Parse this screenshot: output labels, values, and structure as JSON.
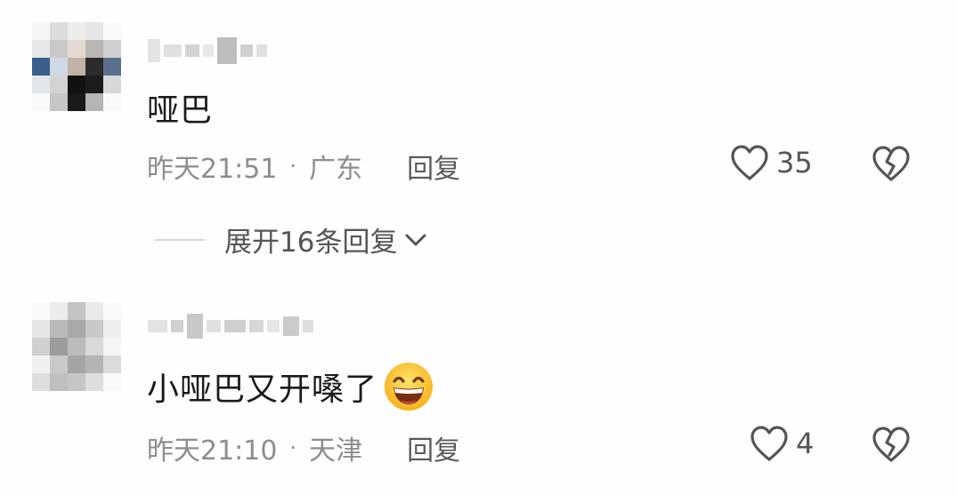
{
  "comments": [
    {
      "text": "哑巴",
      "time": "昨天21:51",
      "separator": "·",
      "location": "广东",
      "reply_label": "回复",
      "likes": "35",
      "expand_label": "展开16条回复"
    },
    {
      "text": "小哑巴又开嗓了",
      "emoji": "grinning-face-emoji",
      "time": "昨天21:10",
      "separator": "·",
      "location": "天津",
      "reply_label": "回复",
      "likes": "4"
    }
  ],
  "colors": {
    "text": "#1a1a1a",
    "meta": "#8d8d8d",
    "icon": "#555555",
    "background": "#fefefe"
  }
}
